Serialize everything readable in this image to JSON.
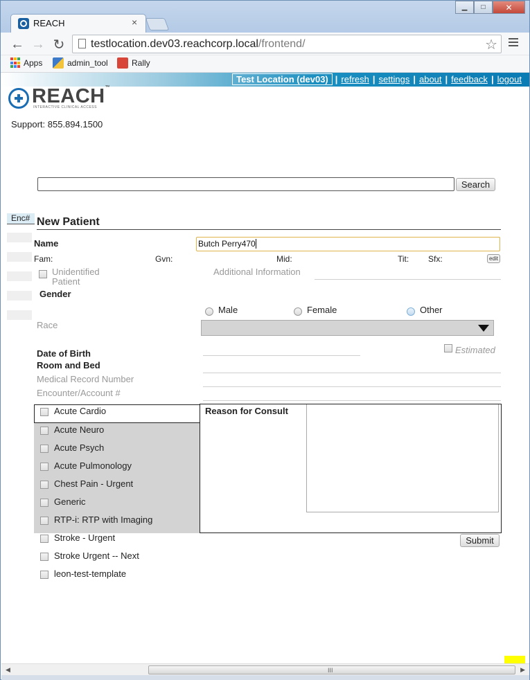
{
  "browser": {
    "tab_title": "REACH",
    "tab_close": "×",
    "url_host": "testlocation.dev03.reachcorp.local",
    "url_path": "/frontend/",
    "back": "←",
    "forward": "→",
    "reload": "↻",
    "star": "☆",
    "bookmarks": [
      {
        "label": "Apps",
        "icon": "apps-grid-icon"
      },
      {
        "label": "admin_tool",
        "icon": "admin-tool-icon"
      },
      {
        "label": "Rally",
        "icon": "rally-icon"
      }
    ],
    "window_buttons": {
      "minimize": "▁",
      "maximize": "□",
      "close": "✕"
    }
  },
  "topnav": {
    "location": "Test Location (dev03)",
    "links": [
      "refresh",
      "settings",
      "about",
      "feedback",
      "logout"
    ],
    "separator": "|"
  },
  "logo": {
    "text": "REACH",
    "tm": "™",
    "subtitle": "INTERACTIVE CLINICAL ACCESS"
  },
  "support": "Support: 855.894.1500",
  "search": {
    "value": "",
    "button": "Search"
  },
  "sidebar": {
    "enc_tab": "Enc#"
  },
  "form": {
    "title": "New Patient",
    "name_label": "Name",
    "name_value": "Butch Perry470",
    "name_parts": {
      "fam": "Fam:",
      "gvn": "Gvn:",
      "mid": "Mid:",
      "tit": "Tit:",
      "sfx": "Sfx:"
    },
    "edit_button": "edit",
    "unidentified_line1": "Unidentified",
    "unidentified_line2": "Patient",
    "additional_info": "Additional Information",
    "gender_label": "Gender",
    "gender_options": [
      "Male",
      "Female",
      "Other"
    ],
    "race_label": "Race",
    "dob_label": "Date of Birth",
    "estimated_label": "Estimated",
    "room_label": "Room and Bed",
    "mrn_label": "Medical Record Number",
    "encounter_label": "Encounter/Account #",
    "templates": [
      "Acute Cardio",
      "Acute Neuro",
      "Acute Psych",
      "Acute Pulmonology",
      "Chest Pain - Urgent",
      "Generic",
      "RTP-i: RTP with Imaging",
      "Stroke - Urgent",
      "Stroke Urgent -- Next",
      "leon-test-template"
    ],
    "reason_label": "Reason for Consult",
    "reason_value": "",
    "submit": "Submit"
  },
  "colors": {
    "accent": "#0b7bb3",
    "logo_blue": "#1a6db3",
    "panel_gray": "#d3d3d3"
  }
}
